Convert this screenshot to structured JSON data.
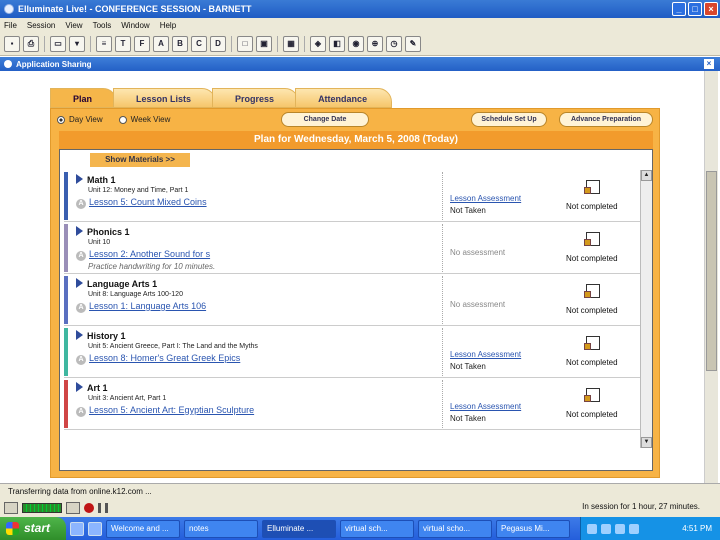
{
  "window": {
    "title": "Elluminate Live! - CONFERENCE SESSION - BARNETT",
    "menus": [
      "File",
      "Session",
      "View",
      "Tools",
      "Window",
      "Help"
    ],
    "minimize": "_",
    "maximize": "□",
    "close": "×"
  },
  "toolbar": {
    "icons": [
      "save-icon",
      "print-icon",
      "display-icon",
      "list-icon",
      "text-icon",
      "font-icon",
      "fill-icon",
      "text-box-icon",
      "id-icon",
      "whiteboard-icon",
      "screen-icon",
      "grid-icon",
      "map-icon",
      "app-share-icon",
      "globe-icon",
      "timer-icon",
      "quiz-icon"
    ]
  },
  "app_sharing": {
    "title": "Application Sharing"
  },
  "tabs": [
    "Plan",
    "Lesson Lists",
    "Progress",
    "Attendance"
  ],
  "view": {
    "day_view": "Day View",
    "week_view": "Week View",
    "change_date": "Change Date",
    "schedule_setup": "Schedule Set Up",
    "advance_preparation": "Advance Preparation"
  },
  "plan": {
    "heading": "Plan for Wednesday, March 5, 2008 (Today)",
    "show_materials": "Show Materials >>",
    "lessons": [
      {
        "subject": "Math 1",
        "unit": "Unit 12: Money and Time, Part 1",
        "lesson": "Lesson 5: Count Mixed Coins",
        "note": "",
        "assessment": "Lesson Assessment",
        "assessment_status": "Not Taken",
        "completion": "Not completed",
        "color": "#3a5fb0"
      },
      {
        "subject": "Phonics 1",
        "unit": "Unit 10",
        "lesson": "Lesson 2: Another Sound for s",
        "note": "Practice handwriting for 10 minutes.",
        "assessment": "No assessment",
        "assessment_status": "",
        "completion": "Not completed",
        "color": "#9a8fb8"
      },
      {
        "subject": "Language Arts 1",
        "unit": "Unit 8: Language Arts 100-120",
        "lesson": "Lesson 1: Language Arts 106",
        "note": "",
        "assessment": "No assessment",
        "assessment_status": "",
        "completion": "Not completed",
        "color": "#5a6fc0"
      },
      {
        "subject": "History 1",
        "unit": "Unit 5: Ancient Greece, Part I: The Land and the Myths",
        "lesson": "Lesson 8: Homer's Great Greek Epics",
        "note": "",
        "assessment": "Lesson Assessment",
        "assessment_status": "Not Taken",
        "completion": "Not completed",
        "color": "#3fb7a0"
      },
      {
        "subject": "Art 1",
        "unit": "Unit 3: Ancient Art, Part 1",
        "lesson": "Lesson 5: Ancient Art: Egyptian Sculpture",
        "note": "",
        "assessment": "Lesson Assessment",
        "assessment_status": "Not Taken",
        "completion": "Not completed",
        "color": "#d04545"
      }
    ]
  },
  "status": {
    "message": "Transferring data from online.k12.com ...",
    "session": "In session for 1 hour, 27 minutes."
  },
  "taskbar": {
    "start": "start",
    "tasks": [
      "Welcome and ...",
      "notes",
      "Elluminate ...",
      "virtual sch...",
      "virtual scho...",
      "Pegasus Mi..."
    ],
    "active_task": 2,
    "clock": "4:51 PM"
  }
}
